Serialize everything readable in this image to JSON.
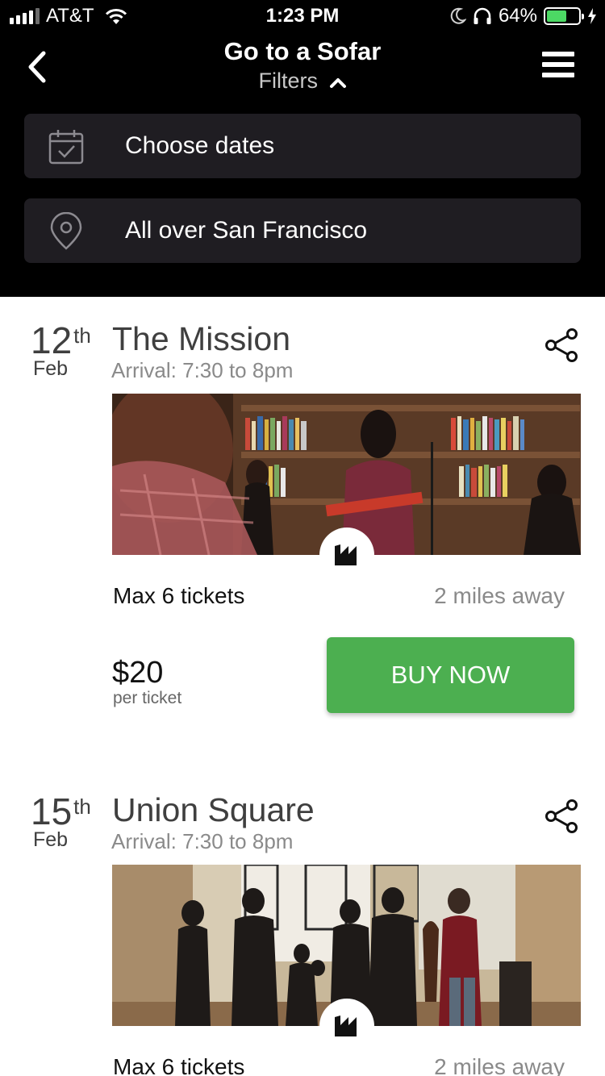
{
  "status_bar": {
    "carrier": "AT&T",
    "time": "1:23 PM",
    "battery_percent": "64%",
    "battery_level": 0.64,
    "icons": [
      "signal-icon",
      "wifi-icon",
      "moon-icon",
      "headphones-icon",
      "battery-icon",
      "charging-icon"
    ]
  },
  "nav": {
    "title": "Go to a Sofar",
    "filters_label": "Filters",
    "icons": [
      "back-chevron-icon",
      "chevron-up-icon",
      "menu-icon"
    ]
  },
  "filters": {
    "dates_label": "Choose dates",
    "location_label": "All over San Francisco",
    "icons": [
      "calendar-check-icon",
      "map-pin-icon"
    ]
  },
  "events": [
    {
      "day": "12",
      "day_suffix": "th",
      "month": "Feb",
      "title": "The Mission",
      "arrival": "Arrival: 7:30 to 8pm",
      "max_tickets": "Max 6 tickets",
      "distance": "2 miles away",
      "price": "$20",
      "price_unit": "per ticket",
      "buy_label": "BUY NOW"
    },
    {
      "day": "15",
      "day_suffix": "th",
      "month": "Feb",
      "title": "Union Square",
      "arrival": "Arrival: 7:30 to 8pm",
      "max_tickets": "Max 6 tickets",
      "distance": "2 miles away"
    }
  ],
  "colors": {
    "header_bg": "#000000",
    "filter_bg": "#1f1d22",
    "buy_button": "#4caf50",
    "battery": "#4cd964",
    "title_text": "#3f3f3f",
    "muted_text": "#8a8a8a"
  }
}
